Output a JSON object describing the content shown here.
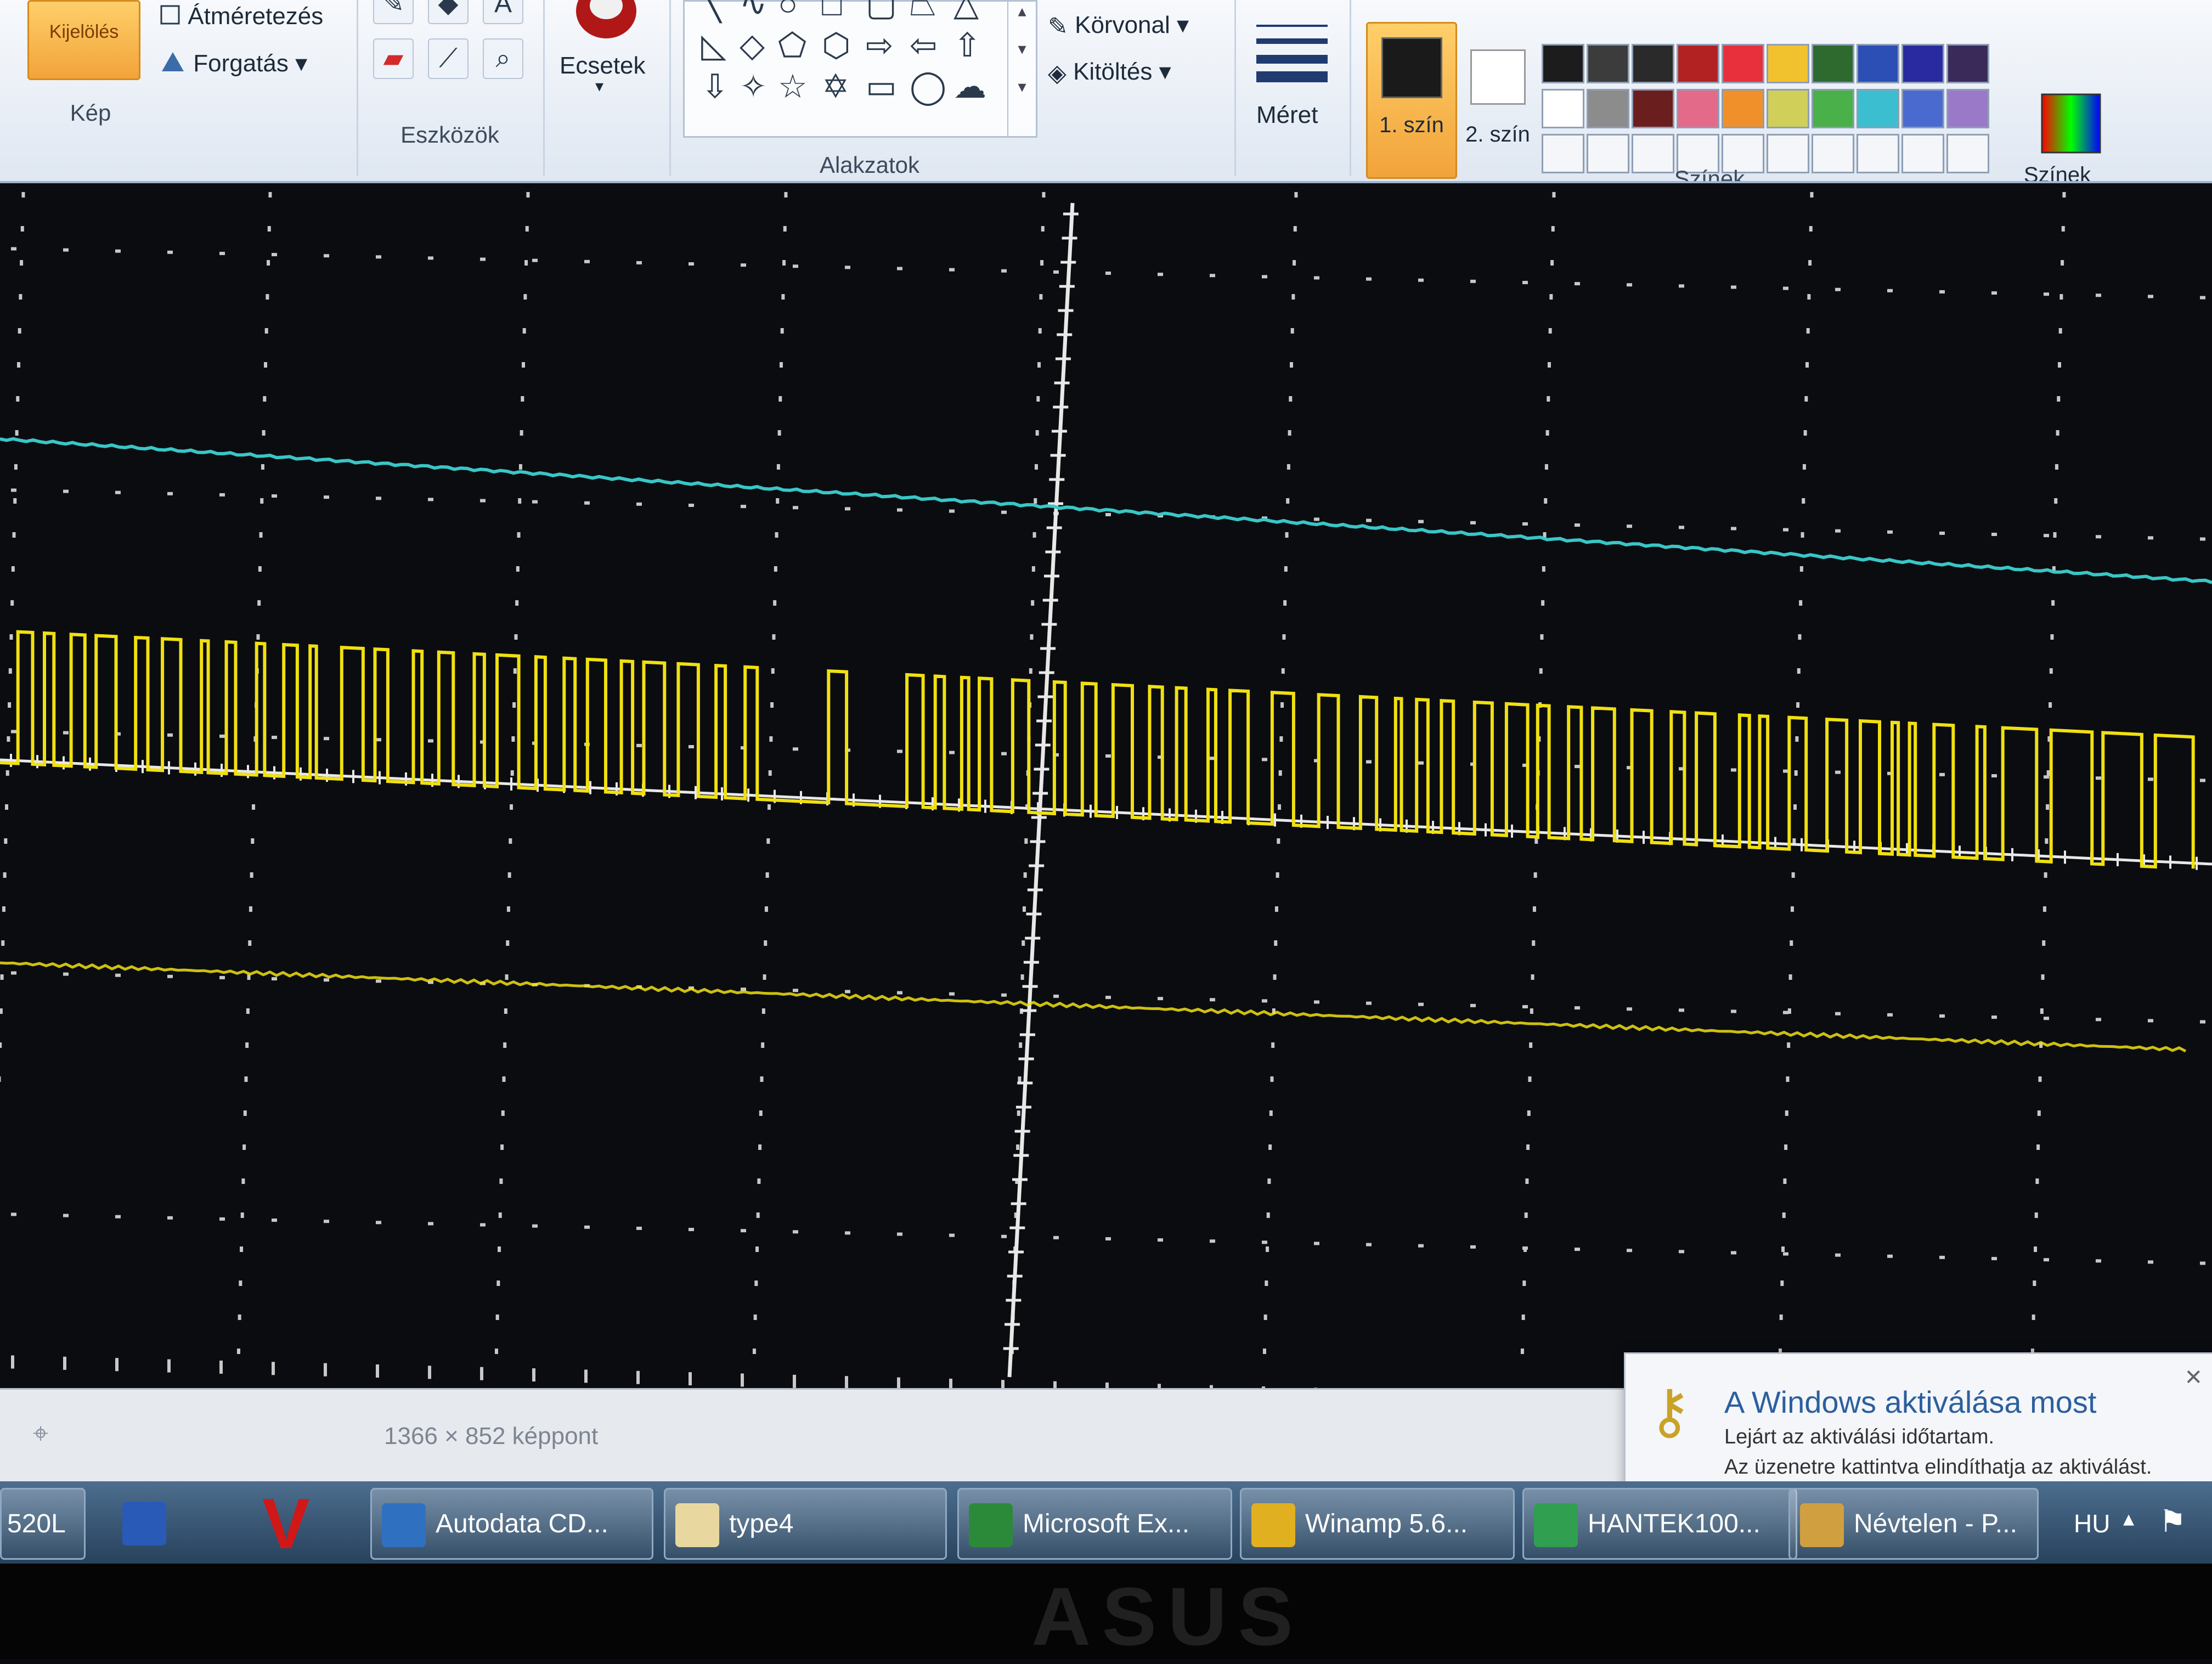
{
  "ribbon": {
    "kep": {
      "select_label": "Kijelölés",
      "resize_label": "Átméretezés",
      "rotate_label": "Forgatás ▾",
      "group_label": "Kép"
    },
    "eszkozok": {
      "group_label": "Eszközök"
    },
    "ecsetek": {
      "label": "Ecsetek"
    },
    "alakzatok": {
      "outline_label": "Körvonal ▾",
      "fill_label": "Kitöltés ▾",
      "group_label": "Alakzatok"
    },
    "meret": {
      "label": "Méret"
    },
    "szinek": {
      "color1_label": "1. szín",
      "color2_label": "2. szín",
      "edit_label": "Színek szerkesztése",
      "group_label": "Színek",
      "palette_row1": [
        "#1c1c1c",
        "#3c3c3c",
        "#2a2a2a",
        "#b22222",
        "#e8303c",
        "#f2c12e",
        "#2e6a2e",
        "#2b4fb5",
        "#2a2aa0",
        "#3a2a5a"
      ],
      "palette_row2": [
        "#ffffff",
        "#8c8c8c",
        "#6b1e1e",
        "#e46a8a",
        "#f0902a",
        "#cfcf5a",
        "#4ab04a",
        "#3bbfd0",
        "#4a6ad0",
        "#9a7ac8"
      ]
    }
  },
  "scope": {
    "colors": {
      "cyan_trace": "#39c6c6",
      "yellow_trace": "#f0e010",
      "grid": "#c8c8c8",
      "axis": "#e8e8e8",
      "background": "#0b0c10"
    }
  },
  "statusbar": {
    "size_text": "1366 × 852 képpont"
  },
  "notification": {
    "title": "A Windows aktiválása most",
    "line1": "Lejárt az aktiválási időtartam.",
    "line2": "Az üzenetre kattintva elindíthatja az aktiválást."
  },
  "taskbar": {
    "items": [
      {
        "label": "520L",
        "color": "#7a8aa0"
      },
      {
        "label": "",
        "color": "#2a5ab8"
      },
      {
        "label": "",
        "color": "#d01818"
      },
      {
        "label": "Autodata CD...",
        "color": "#3070c0"
      },
      {
        "label": "type4",
        "color": "#e8d8a0"
      },
      {
        "label": "Microsoft Ex...",
        "color": "#2a8a3a"
      },
      {
        "label": "Winamp 5.6...",
        "color": "#e0b020"
      },
      {
        "label": "HANTEK100...",
        "color": "#30a050"
      },
      {
        "label": "Névtelen - P...",
        "color": "#d0a040"
      }
    ],
    "lang": "HU"
  },
  "bezel": {
    "brand": "ASUS"
  }
}
